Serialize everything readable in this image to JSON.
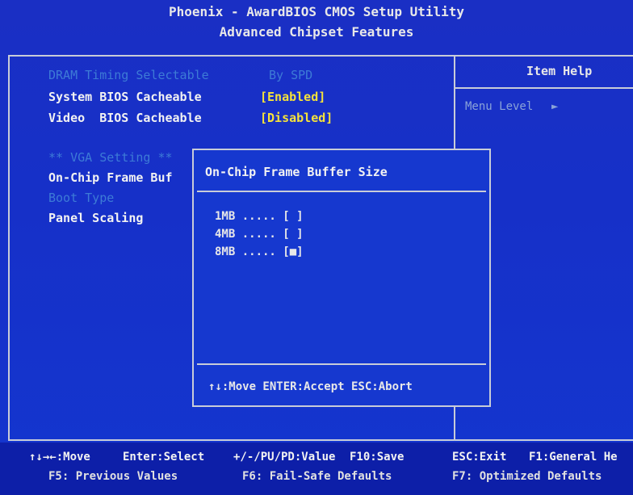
{
  "header": {
    "title": "Phoenix - AwardBIOS CMOS Setup Utility",
    "subtitle": "Advanced Chipset Features"
  },
  "help_panel": {
    "title": "Item Help",
    "menu_level": "Menu Level",
    "menu_level_arrow": "►"
  },
  "settings": [
    {
      "label": "DRAM Timing Selectable",
      "value": "By SPD",
      "enabled": false
    },
    {
      "label": "System BIOS Cacheable",
      "value": "[Enabled]",
      "enabled": true
    },
    {
      "label": "Video  BIOS Cacheable",
      "value": "[Disabled]",
      "enabled": true
    }
  ],
  "vga_section": {
    "header": "** VGA Setting **",
    "frame_buffer_label": "On-Chip Frame Buf",
    "boot_type_label": "Boot Type",
    "panel_scaling_label": "Panel Scaling"
  },
  "popup": {
    "title": "On-Chip Frame Buffer Size",
    "options": [
      {
        "label": "1MB ..... [ ]",
        "selected": false
      },
      {
        "label": "4MB ..... [ ]",
        "selected": false
      },
      {
        "label": "8MB ..... [■]",
        "selected": true
      }
    ],
    "footer": "↑↓:Move ENTER:Accept ESC:Abort"
  },
  "footer": {
    "move": "↑↓→←:Move",
    "enter": "Enter:Select",
    "value": "+/-/PU/PD:Value",
    "save": "F10:Save",
    "exit": "ESC:Exit",
    "help": "F1:General He",
    "prev": "F5: Previous Values",
    "failsafe": "F6: Fail-Safe Defaults",
    "optimized": "F7: Optimized Defaults"
  },
  "colors": {
    "background": "#1630c8",
    "value_yellow": "#f5e23a",
    "dim_text": "#3d7bd6",
    "border": "#c8ccd8"
  }
}
